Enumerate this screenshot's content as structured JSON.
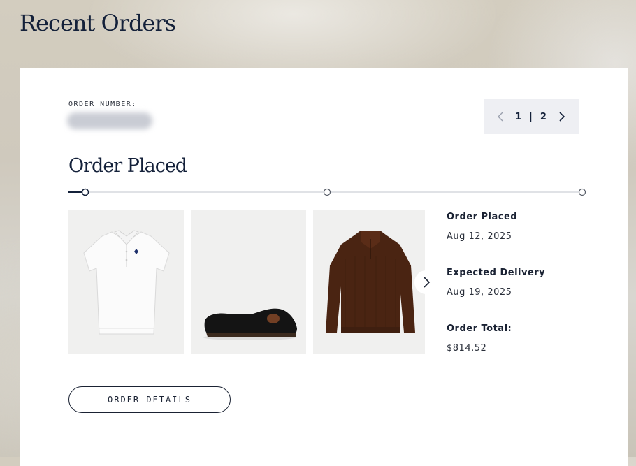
{
  "page": {
    "title": "Recent Orders"
  },
  "order": {
    "number_label": "ORDER NUMBER:",
    "number_value": "",
    "status_title": "Order Placed",
    "progress_steps": 3,
    "progress_active_step": 1
  },
  "pager": {
    "current": "1",
    "separator": "|",
    "total": "2",
    "prev_icon": "chevron-left-icon",
    "next_icon": "chevron-right-icon"
  },
  "products": [
    {
      "name": "white-polo-shirt",
      "color": "#ffffff"
    },
    {
      "name": "black-velvet-loafer",
      "color": "#141414"
    },
    {
      "name": "brown-quarter-zip-sweater",
      "color": "#4a2412"
    }
  ],
  "carousel": {
    "next_icon": "chevron-right-icon"
  },
  "info": {
    "placed_label": "Order Placed",
    "placed_date": "Aug 12, 2025",
    "delivery_label": "Expected Delivery",
    "delivery_date": "Aug 19, 2025",
    "total_label": "Order Total:",
    "total_value": "$814.52"
  },
  "actions": {
    "details_label": "ORDER DETAILS"
  },
  "colors": {
    "brand_navy": "#14213a",
    "pager_bg": "#eeeff3",
    "card_bg": "#ffffff"
  }
}
